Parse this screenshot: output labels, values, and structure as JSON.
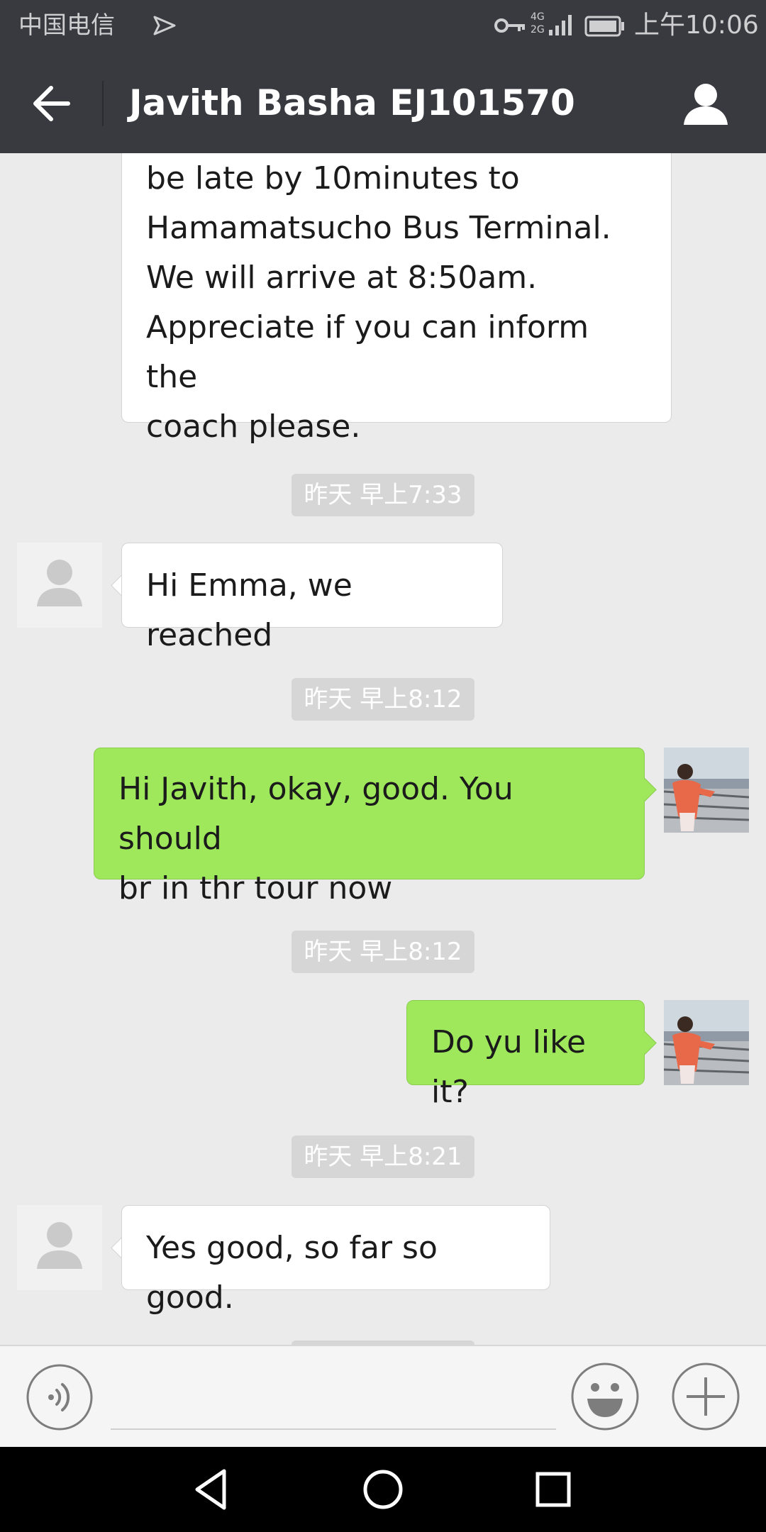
{
  "status_bar": {
    "carrier": "中国电信",
    "network_top": "4G",
    "network_bottom": "2G",
    "time": "上午10:06"
  },
  "header": {
    "title": "Javith Basha EJ101570"
  },
  "messages": [
    {
      "type": "incoming",
      "lines": [
        "be late by 10minutes to",
        "Hamamatsucho Bus Terminal.",
        "We will arrive at 8:50am.",
        "Appreciate if you can inform the",
        "coach please."
      ]
    },
    {
      "type": "timestamp",
      "text": "昨天 早上7:33"
    },
    {
      "type": "incoming",
      "lines": [
        "Hi Emma, we reached"
      ]
    },
    {
      "type": "timestamp",
      "text": "昨天 早上8:12"
    },
    {
      "type": "outgoing",
      "lines": [
        "Hi Javith, okay, good. You should",
        "br in thr tour now"
      ]
    },
    {
      "type": "timestamp",
      "text": "昨天 早上8:12"
    },
    {
      "type": "outgoing",
      "lines": [
        "Do yu like it?"
      ]
    },
    {
      "type": "timestamp",
      "text": "昨天 早上8:21"
    },
    {
      "type": "incoming",
      "lines": [
        "Yes good, so far so good."
      ]
    }
  ],
  "input": {
    "value": "",
    "placeholder": ""
  },
  "colors": {
    "header_bg": "#393a3f",
    "chat_bg": "#ebebeb",
    "outgoing_bubble": "#9fe85c",
    "incoming_bubble": "#ffffff",
    "timestamp_bg": "#d6d6d6"
  },
  "icons": {
    "status": [
      "send-icon",
      "key-icon",
      "signal-icon",
      "battery-icon"
    ],
    "header": [
      "back-arrow-icon",
      "person-icon"
    ],
    "input": [
      "voice-icon",
      "emoji-icon",
      "plus-icon"
    ],
    "nav": [
      "nav-back-icon",
      "nav-home-icon",
      "nav-recent-icon"
    ]
  }
}
